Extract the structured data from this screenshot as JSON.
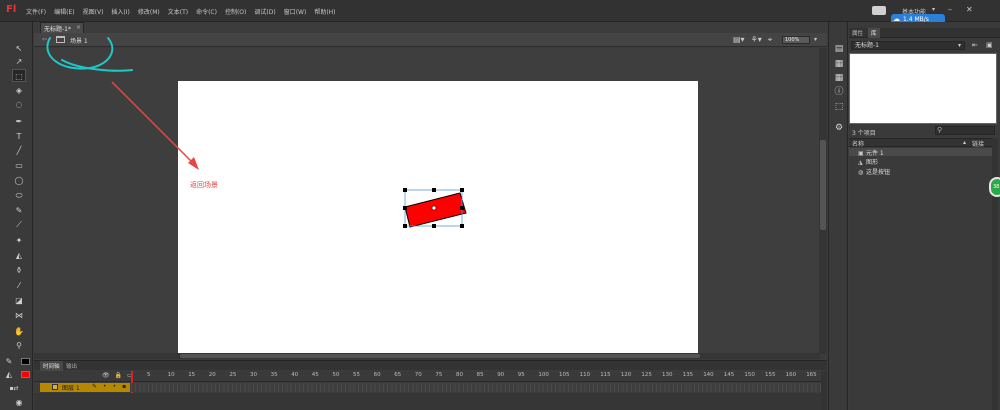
{
  "app": {
    "logo": "Fl",
    "menu": [
      "文件(F)",
      "编辑(E)",
      "视图(V)",
      "插入(I)",
      "修改(M)",
      "文本(T)",
      "命令(C)",
      "控制(O)",
      "调试(D)",
      "窗口(W)",
      "帮助(H)"
    ],
    "workspace_label": "基本功能",
    "network_speed": "1.4 MB/s"
  },
  "document": {
    "tab_label": "无标题-1*",
    "tab_close": "×",
    "scene_label": "场景 1",
    "zoom": "100%"
  },
  "annotation": {
    "text": "返回场景"
  },
  "timeline": {
    "tab_label": "时间轴",
    "output_tab": "输出",
    "frame_numbers": [
      "5",
      "10",
      "15",
      "20",
      "25",
      "30",
      "35",
      "40",
      "45",
      "50",
      "55",
      "60",
      "65",
      "70",
      "75",
      "80",
      "85",
      "90",
      "95",
      "100",
      "105",
      "110",
      "115",
      "120",
      "125",
      "130",
      "135",
      "140",
      "145",
      "150",
      "155",
      "160",
      "165"
    ],
    "layer_name": "图层 1"
  },
  "library": {
    "properties_tab": "属性",
    "library_tab": "库",
    "document_selector": "无标题-1",
    "item_count": "3 个项目",
    "col_name": "名称",
    "col_link": "链接",
    "items": [
      {
        "icon": "movie-clip-icon",
        "name": "元件 1"
      },
      {
        "icon": "graphic-icon",
        "name": "图形"
      },
      {
        "icon": "button-icon",
        "name": "这是按钮"
      }
    ]
  },
  "colors": {
    "rectangle_fill": "#ff0000",
    "annotation": "#e84545",
    "circle_mark": "#1ec8c8",
    "layer": "#b58800",
    "playhead": "#e02020"
  }
}
